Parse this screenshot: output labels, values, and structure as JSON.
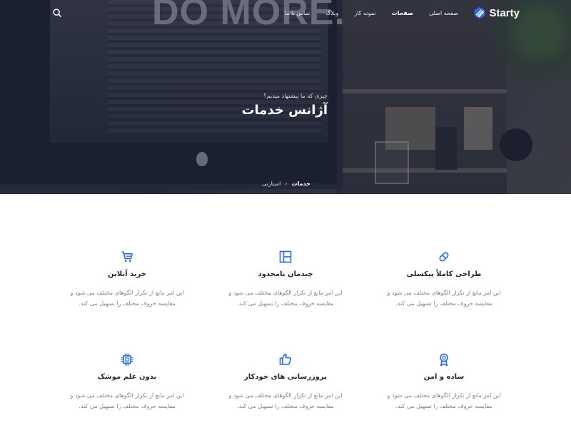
{
  "brand": {
    "name": "Starty",
    "accent": "#2f6fe4"
  },
  "nav": {
    "items": [
      {
        "label": "صفحه اصلی",
        "active": false
      },
      {
        "label": "صفحات",
        "active": true
      },
      {
        "label": "نمونه کار",
        "active": false
      },
      {
        "label": "وبلاگ",
        "active": false
      },
      {
        "label": "تماس با ما",
        "active": false
      }
    ],
    "search_icon": "search-icon"
  },
  "hero": {
    "background_text": "DO MORE.",
    "subtitle": "چیزی که ما پیشنهاد میدیم؟",
    "title": "آژانس خدمات",
    "breadcrumb": [
      {
        "label": "استارتی"
      },
      {
        "label": "خدمات"
      }
    ]
  },
  "features": [
    {
      "icon": "pill-icon",
      "title": "طراحی کاملاً پیکسلی",
      "line1": "این امر مانع از تکرار الگوهای مختلف می شود و",
      "line2": "مقایسه حروف مختلف را تسهیل می کند."
    },
    {
      "icon": "layout-icon",
      "title": "چیدمان نامحدود",
      "line1": "این امر مانع از تکرار الگوهای مختلف می شود و",
      "line2": "مقایسه حروف مختلف را تسهیل می کند."
    },
    {
      "icon": "cart-icon",
      "title": "خرید آنلاین",
      "line1": "این امر مانع از تکرار الگوهای مختلف می شود و",
      "line2": "مقایسه حروف مختلف را تسهیل می کند."
    },
    {
      "icon": "award-icon",
      "title": "ساده و امن",
      "line1": "این امر مانع از تکرار الگوهای مختلف می شود و",
      "line2": "مقایسه حروف مختلف را تسهیل می کند."
    },
    {
      "icon": "thumbs-up-icon",
      "title": "بروزرسانی های خودکار",
      "line1": "این امر مانع از تکرار الگوهای مختلف می شود و",
      "line2": "مقایسه حروف مختلف را تسهیل می کند."
    },
    {
      "icon": "chip-icon",
      "title": "بدون علم موشک",
      "line1": "این امر مانع از تکرار الگوهای مختلف می شود و",
      "line2": "مقایسه حروف مختلف را تسهیل می کند."
    }
  ]
}
